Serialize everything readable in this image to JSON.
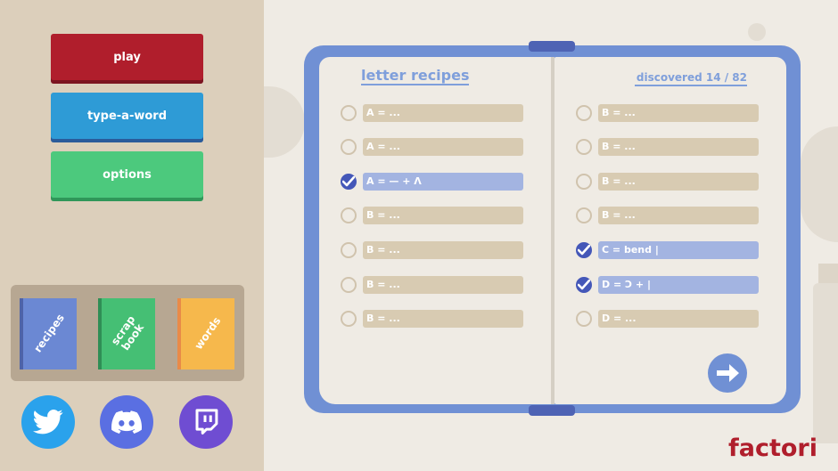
{
  "menu": {
    "play": "play",
    "type_a_word": "type-a-word",
    "options": "options"
  },
  "shelf": {
    "recipes": "recipes",
    "scrap_book": "scrap book",
    "words": "words"
  },
  "social": {
    "twitter": "twitter-icon",
    "discord": "discord-icon",
    "twitch": "twitch-icon"
  },
  "book": {
    "title": "letter recipes",
    "discovered": "discovered 14 / 82",
    "left_rows": [
      {
        "text": "A = ...",
        "done": false
      },
      {
        "text": "A = ...",
        "done": false
      },
      {
        "text": "A = — + Λ",
        "done": true
      },
      {
        "text": "B = ...",
        "done": false
      },
      {
        "text": "B = ...",
        "done": false
      },
      {
        "text": "B = ...",
        "done": false
      },
      {
        "text": "B = ...",
        "done": false
      }
    ],
    "right_rows": [
      {
        "text": "B = ...",
        "done": false
      },
      {
        "text": "B = ...",
        "done": false
      },
      {
        "text": "B = ...",
        "done": false
      },
      {
        "text": "B = ...",
        "done": false
      },
      {
        "text": "C = bend |",
        "done": true
      },
      {
        "text": "D = Ↄ + |",
        "done": true
      },
      {
        "text": "D = ...",
        "done": false
      }
    ]
  },
  "logo": "factori",
  "colors": {
    "play": "#b01e2c",
    "type_a_word": "#2e9bd6",
    "options": "#4cc97d",
    "book": "#7090d4",
    "check": "#4457b8"
  }
}
